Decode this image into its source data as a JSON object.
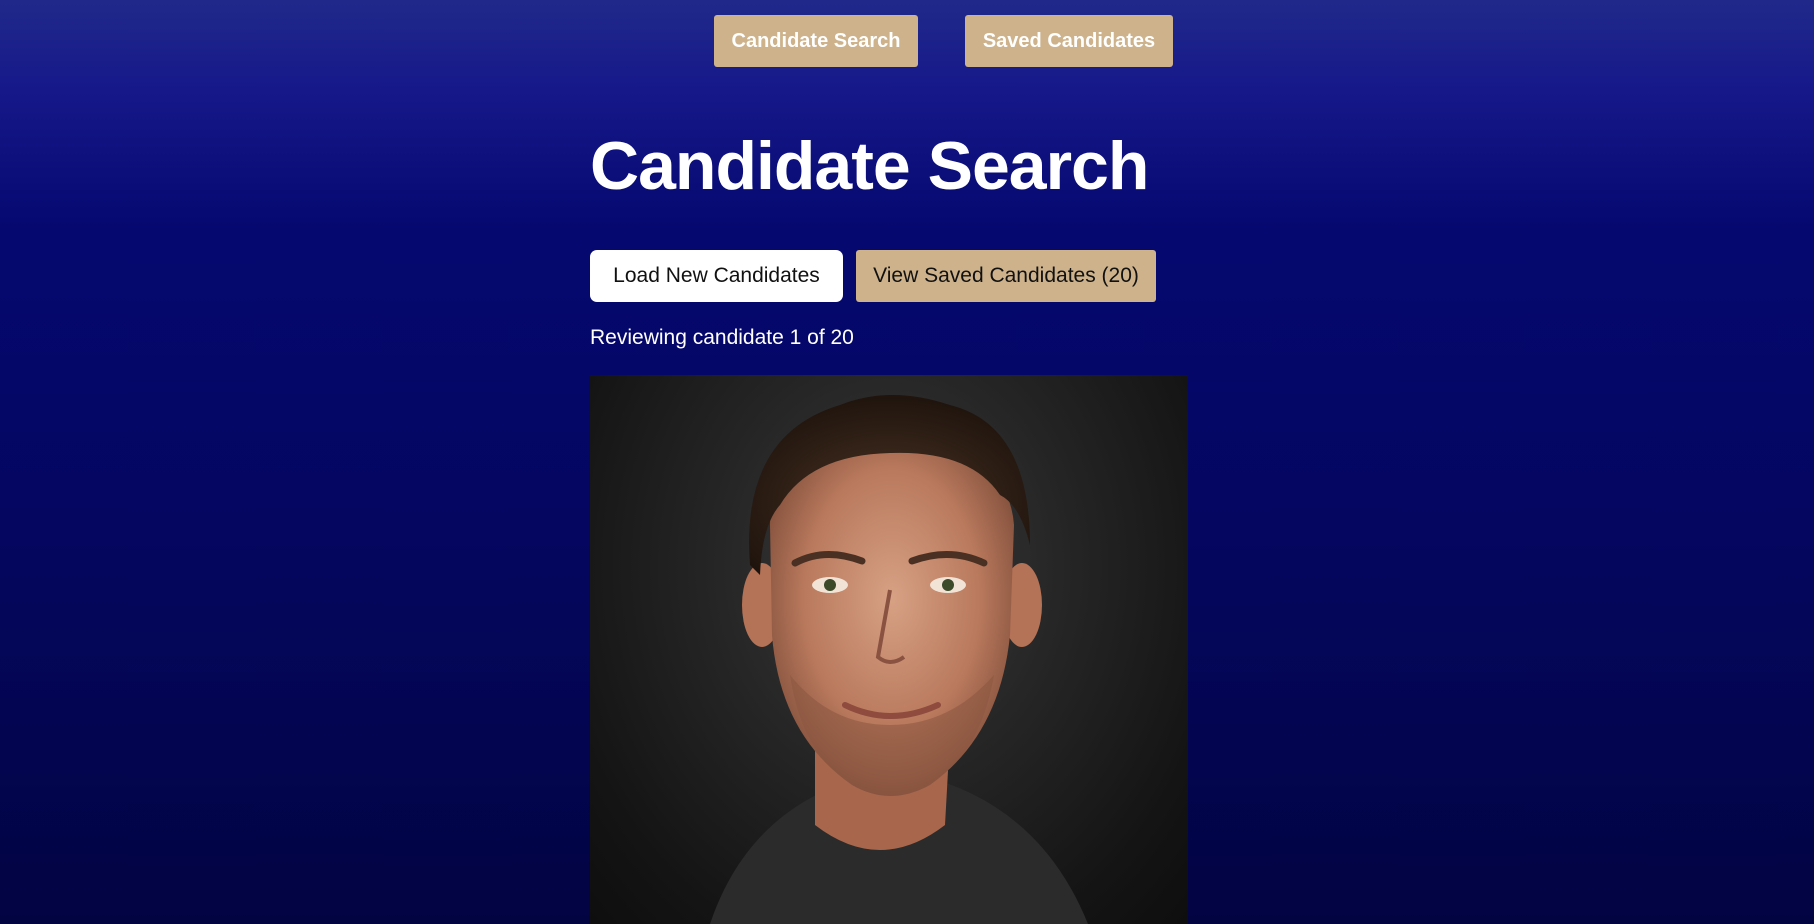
{
  "nav": {
    "candidate_search": "Candidate Search",
    "saved_candidates": "Saved Candidates"
  },
  "page": {
    "title": "Candidate Search"
  },
  "actions": {
    "load_label": "Load New Candidates",
    "view_saved_label": "View Saved Candidates (20)"
  },
  "status": {
    "reviewing": "Reviewing candidate 1 of 20"
  },
  "colors": {
    "accent": "#cdb28b",
    "background_top": "#20298a",
    "background_bottom": "#020442"
  }
}
